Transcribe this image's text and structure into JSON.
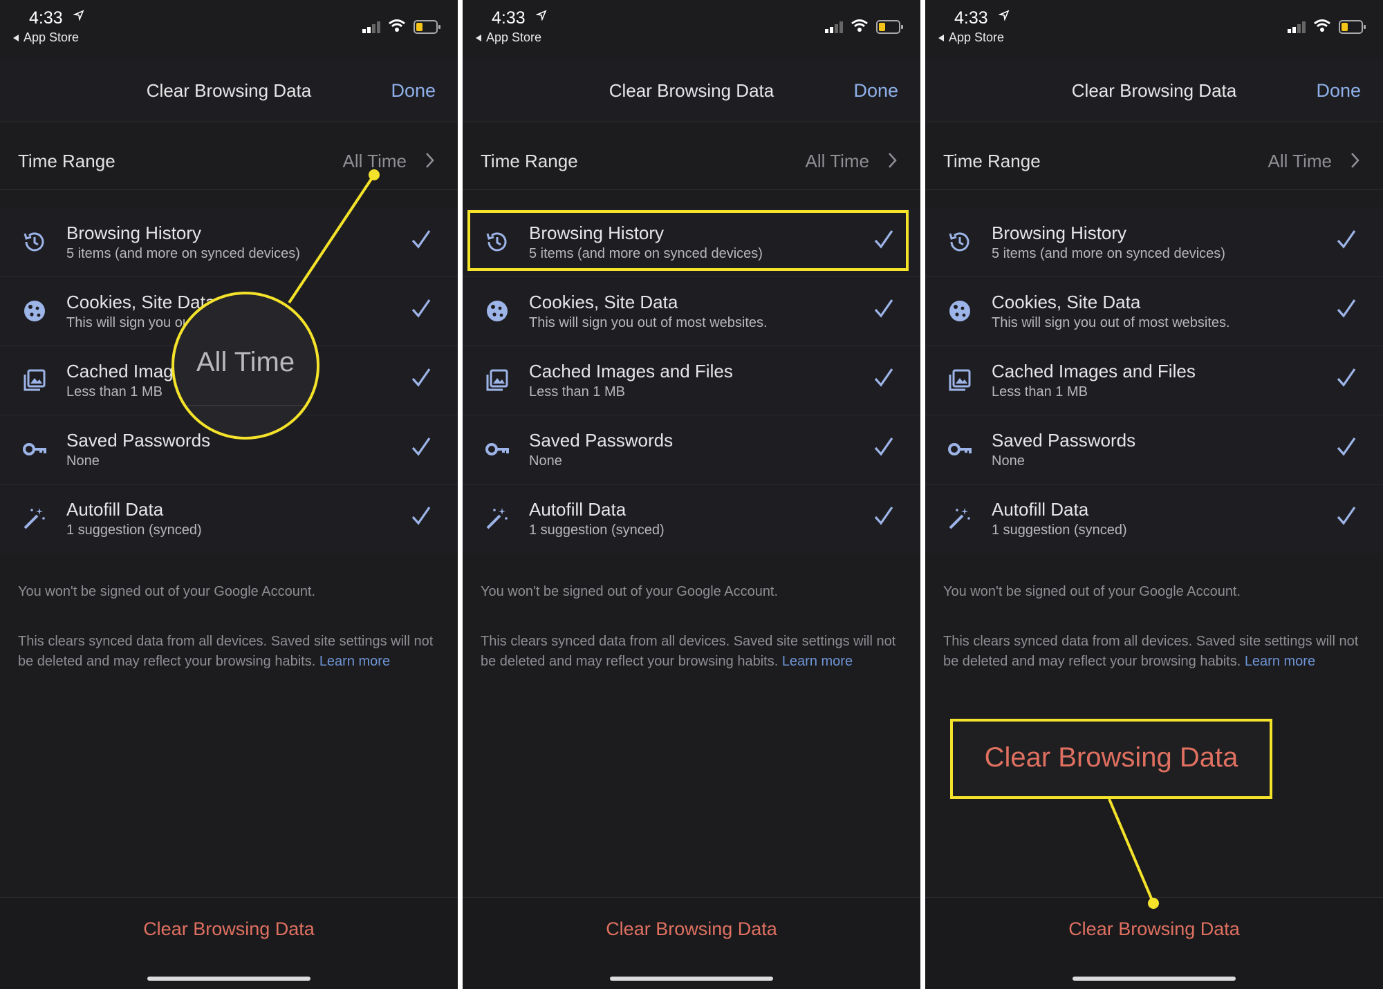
{
  "status_bar": {
    "time": "4:33",
    "back_label": "App Store"
  },
  "nav": {
    "title": "Clear Browsing Data",
    "done_label": "Done"
  },
  "time_range": {
    "label": "Time Range",
    "value": "All Time"
  },
  "items": [
    {
      "title": "Browsing History",
      "subtitle": "5 items (and more on synced devices)",
      "icon": "history-icon",
      "checked": true
    },
    {
      "title": "Cookies, Site Data",
      "subtitle": "This will sign you out of most websites.",
      "icon": "cookie-icon",
      "checked": true
    },
    {
      "title": "Cached Images and Files",
      "subtitle": "Less than 1 MB",
      "icon": "image-icon",
      "checked": true
    },
    {
      "title": "Saved Passwords",
      "subtitle": "None",
      "icon": "key-icon",
      "checked": true
    },
    {
      "title": "Autofill Data",
      "subtitle": "1 suggestion (synced)",
      "icon": "magic-wand-icon",
      "checked": true
    }
  ],
  "footer": {
    "note_signed_out": "You won't be signed out of your Google Account.",
    "note_synced": "This clears synced data from all devices. Saved site settings will not be deleted and may reflect your browsing habits.",
    "learn_more": "Learn more"
  },
  "bottom": {
    "clear_button": "Clear Browsing Data"
  },
  "callouts": {
    "zoom_text": "All Time",
    "clear_box_text": "Clear Browsing Data"
  },
  "colors": {
    "background": "#1c1c1f",
    "accent_blue": "#8fb0ea",
    "destructive_red": "#e07060",
    "highlight_yellow": "#f4e32a",
    "icon_blue": "#9db4e8"
  }
}
